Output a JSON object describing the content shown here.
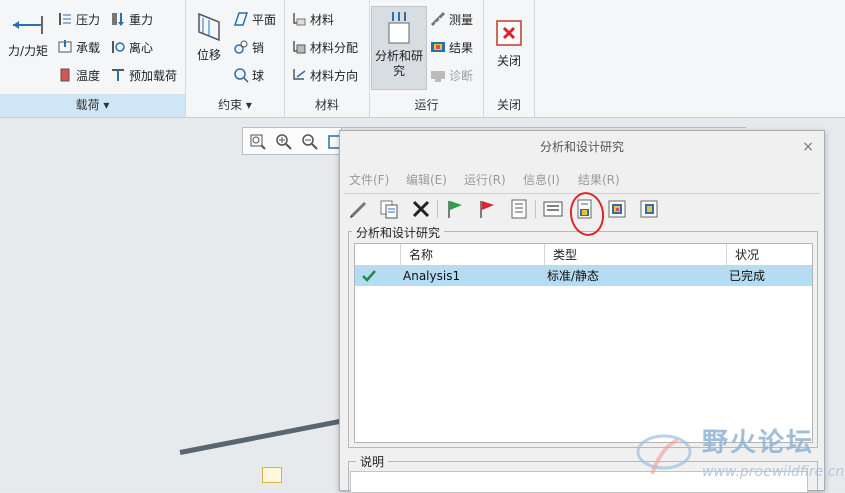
{
  "ribbon": {
    "load_group": {
      "force_moment": "力/力矩",
      "pressure": "压力",
      "gravity": "重力",
      "bearing": "承载",
      "centrifugal": "离心",
      "temperature": "温度",
      "preload": "预加载荷",
      "footer": "载荷"
    },
    "constraint_group": {
      "displacement": "位移",
      "plane": "平面",
      "pin": "销",
      "ball": "球",
      "footer": "约束"
    },
    "material_group": {
      "material": "材料",
      "material_assign": "材料分配",
      "material_direction": "材料方向",
      "footer": "材料"
    },
    "run_group": {
      "analysis_study_line1": "分析和研",
      "analysis_study_line2": "究",
      "measure": "测量",
      "results": "结果",
      "diagnose": "诊断",
      "footer": "运行"
    },
    "close_group": {
      "close": "关闭",
      "footer": "关闭"
    }
  },
  "dialog": {
    "title": "分析和设计研究",
    "close_glyph": "×",
    "menu": [
      "文件(F)",
      "编辑(E)",
      "运行(R)",
      "信息(I)",
      "结果(R)"
    ],
    "section_label": "分析和设计研究",
    "table": {
      "headers": [
        "名称",
        "类型",
        "状况"
      ],
      "rows": [
        {
          "name": "Analysis1",
          "type": "标准/静态",
          "status": "已完成"
        }
      ]
    },
    "description_label": "说明"
  },
  "watermark": {
    "title": "野火论坛",
    "url": "www.proewildfire.cn"
  },
  "colors": {
    "accent_footer": "#cfe6f6",
    "selected_row": "#b5dcf3",
    "highlight_ring": "#e0262b"
  }
}
